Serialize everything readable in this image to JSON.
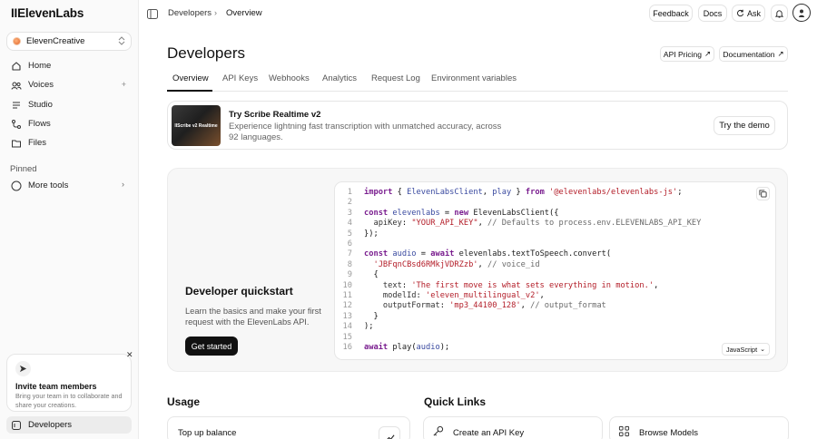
{
  "app": {
    "logo": "IIElevenLabs",
    "workspace": "ElevenCreative"
  },
  "sidebar": {
    "items": [
      {
        "label": "Home"
      },
      {
        "label": "Voices",
        "action": "+"
      },
      {
        "label": "Studio"
      },
      {
        "label": "Flows"
      },
      {
        "label": "Files"
      }
    ],
    "pinned_heading": "Pinned",
    "pinned_items": [
      {
        "label": "More tools"
      }
    ],
    "invite": {
      "title": "Invite team members",
      "description": "Bring your team in to collaborate and share your creations."
    },
    "active_item": "Developers"
  },
  "topbar": {
    "breadcrumb": [
      "Developers",
      "Overview"
    ],
    "buttons": {
      "feedback": "Feedback",
      "docs": "Docs",
      "ask": "Ask"
    }
  },
  "header": {
    "title": "Developers",
    "api_pricing": "API Pricing",
    "documentation": "Documentation"
  },
  "tabs": [
    {
      "label": "Overview",
      "active": true
    },
    {
      "label": "API Keys"
    },
    {
      "label": "Webhooks"
    },
    {
      "label": "Analytics"
    },
    {
      "label": "Request Log"
    },
    {
      "label": "Environment variables"
    }
  ],
  "promo": {
    "image_text": "IIScribe v2 Realtime",
    "title": "Try Scribe Realtime v2",
    "description": "Experience lightning fast transcription with unmatched accuracy, across 92 languages.",
    "button": "Try the demo"
  },
  "quickstart": {
    "title": "Developer quickstart",
    "description": "Learn the basics and make your first request with the ElevenLabs API.",
    "button": "Get started",
    "language": "JavaScript",
    "line_numbers": [
      "1",
      "2",
      "3",
      "4",
      "5",
      "6",
      "7",
      "8",
      "9",
      "10",
      "11",
      "12",
      "13",
      "14",
      "15",
      "16"
    ]
  },
  "usage": {
    "title": "Usage",
    "card_label": "Top up balance"
  },
  "quick_links": {
    "title": "Quick Links",
    "items": [
      {
        "label": "Create an API Key"
      },
      {
        "label": "Browse Models"
      }
    ]
  }
}
